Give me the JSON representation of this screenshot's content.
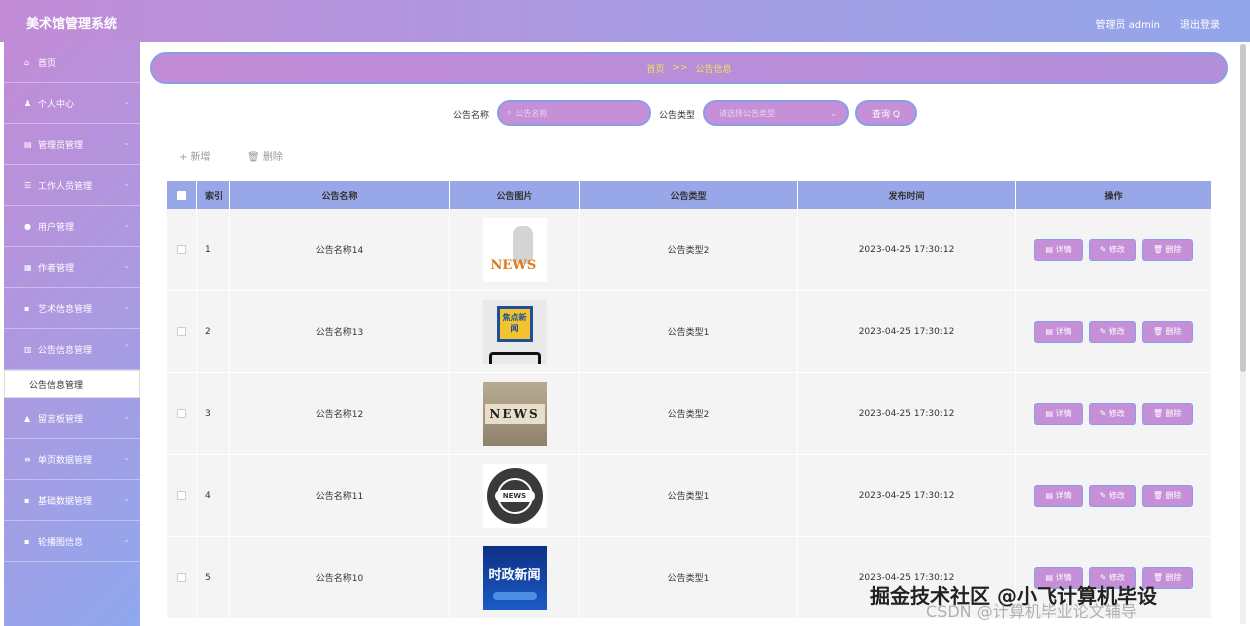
{
  "header": {
    "app_title": "美术馆管理系统",
    "user": "管理员 admin",
    "logout": "退出登录"
  },
  "sidebar": {
    "items": [
      {
        "icon": "home-icon",
        "glyph": "⌂",
        "label": "首页"
      },
      {
        "icon": "user-icon",
        "glyph": "♟",
        "label": "个人中心"
      },
      {
        "icon": "admin-icon",
        "glyph": "▤",
        "label": "管理员管理"
      },
      {
        "icon": "list-icon",
        "glyph": "☰",
        "label": "工作人员管理"
      },
      {
        "icon": "person-icon",
        "glyph": "●",
        "label": "用户管理"
      },
      {
        "icon": "author-icon",
        "glyph": "▦",
        "label": "作者管理"
      },
      {
        "icon": "grid-icon",
        "glyph": "▪",
        "label": "艺术信息管理"
      },
      {
        "icon": "notice-icon",
        "glyph": "▥",
        "label": "公告信息管理"
      }
    ],
    "sub_item": "公告信息管理",
    "items_after": [
      {
        "icon": "message-icon",
        "glyph": "▲",
        "label": "留言板管理"
      },
      {
        "icon": "sliders-icon",
        "glyph": "≡",
        "label": "单页数据管理"
      },
      {
        "icon": "grid-icon",
        "glyph": "▪",
        "label": "基础数据管理"
      },
      {
        "icon": "grid-icon",
        "glyph": "▪",
        "label": "轮播图信息"
      }
    ]
  },
  "breadcrumb": {
    "home": "首页",
    "sep": ">>",
    "current": "公告信息"
  },
  "search": {
    "name_label": "公告名称",
    "name_placeholder": "公告名称",
    "type_label": "公告类型",
    "type_placeholder": "请选择公告类型",
    "query_label": "查询 Q"
  },
  "actions": {
    "add": "+ 新增",
    "delete": "🗑 删除"
  },
  "table": {
    "headers": {
      "index": "索引",
      "name": "公告名称",
      "image": "公告图片",
      "type": "公告类型",
      "time": "发布时间",
      "ops": "操作"
    },
    "op_labels": {
      "detail": "▤ 详情",
      "edit": "✎ 修改",
      "delete": "🗑 删除"
    },
    "rows": [
      {
        "index": "1",
        "name": "公告名称14",
        "image_text": "NEWS",
        "type": "公告类型2",
        "time": "2023-04-25 17:30:12"
      },
      {
        "index": "2",
        "name": "公告名称13",
        "image_text": "焦点新闻",
        "type": "公告类型1",
        "time": "2023-04-25 17:30:12"
      },
      {
        "index": "3",
        "name": "公告名称12",
        "image_text": "NEWS",
        "type": "公告类型2",
        "time": "2023-04-25 17:30:12"
      },
      {
        "index": "4",
        "name": "公告名称11",
        "image_text": "NEWS",
        "type": "公告类型1",
        "time": "2023-04-25 17:30:12"
      },
      {
        "index": "5",
        "name": "公告名称10",
        "image_text": "时政新闻",
        "type": "公告类型1",
        "time": "2023-04-25 17:30:12"
      }
    ]
  },
  "watermark": {
    "line1": "掘金技术社区 @小飞计算机毕设",
    "line2": "CSDN @计算机毕业论文辅导"
  }
}
